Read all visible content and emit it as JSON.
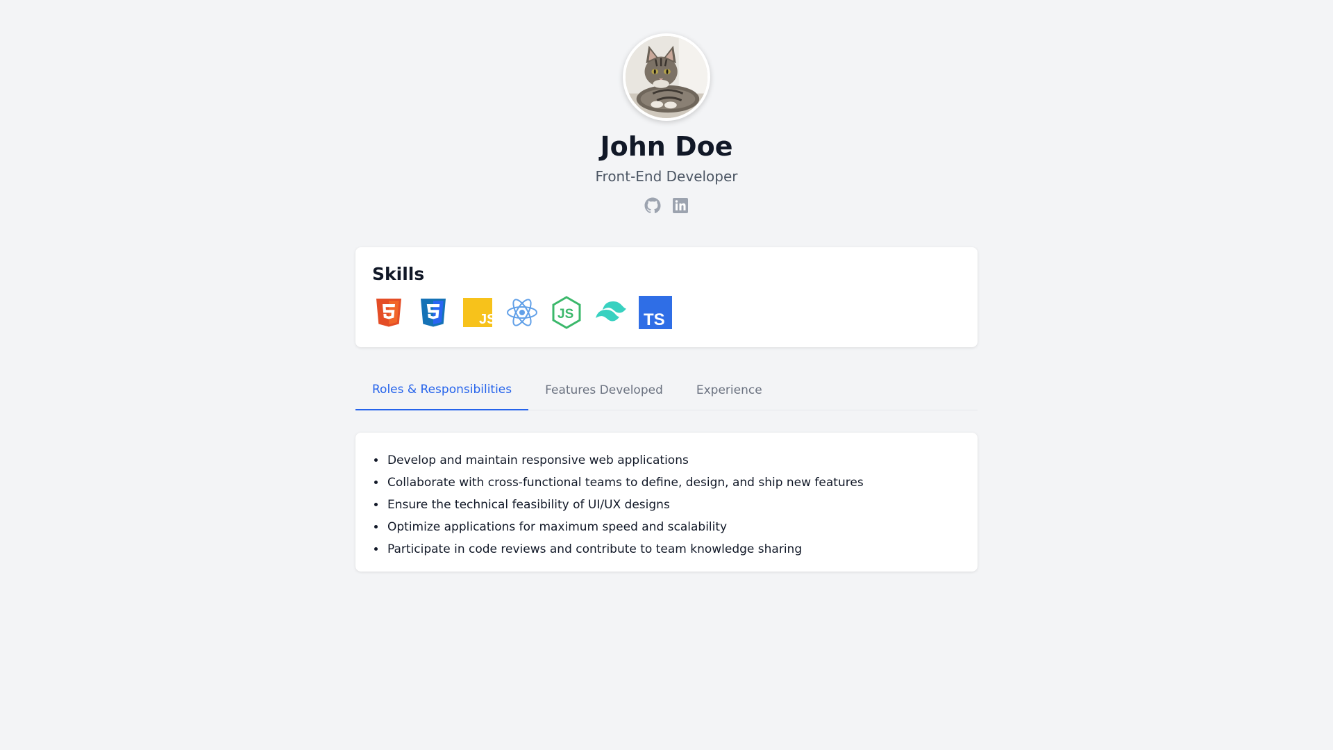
{
  "profile": {
    "name": "John Doe",
    "title": "Front-End Developer",
    "socials": [
      {
        "icon": "github-icon",
        "color": "#9ca3af"
      },
      {
        "icon": "linkedin-icon",
        "color": "#9ca3af"
      }
    ]
  },
  "skills": {
    "heading": "Skills",
    "icons": [
      {
        "icon": "html5-icon",
        "color": "#f16529"
      },
      {
        "icon": "css3-icon",
        "color": "#2965f1"
      },
      {
        "icon": "javascript-icon",
        "color": "#f7c21b"
      },
      {
        "icon": "react-icon",
        "color": "#61a0e8"
      },
      {
        "icon": "nodejs-icon",
        "color": "#3bb86b"
      },
      {
        "icon": "tailwind-icon",
        "color": "#38d1c0"
      },
      {
        "icon": "typescript-icon",
        "color": "#2f6ee6"
      }
    ]
  },
  "tabs": [
    {
      "label": "Roles & Responsibilities",
      "active": true
    },
    {
      "label": "Features Developed",
      "active": false
    },
    {
      "label": "Experience",
      "active": false
    }
  ],
  "responsibilities": [
    "Develop and maintain responsive web applications",
    "Collaborate with cross-functional teams to define, design, and ship new features",
    "Ensure the technical feasibility of UI/UX designs",
    "Optimize applications for maximum speed and scalability",
    "Participate in code reviews and contribute to team knowledge sharing"
  ],
  "theme": {
    "accent": "#2563eb",
    "background": "#f3f4f6",
    "card": "#ffffff",
    "muted": "#6b7280"
  }
}
